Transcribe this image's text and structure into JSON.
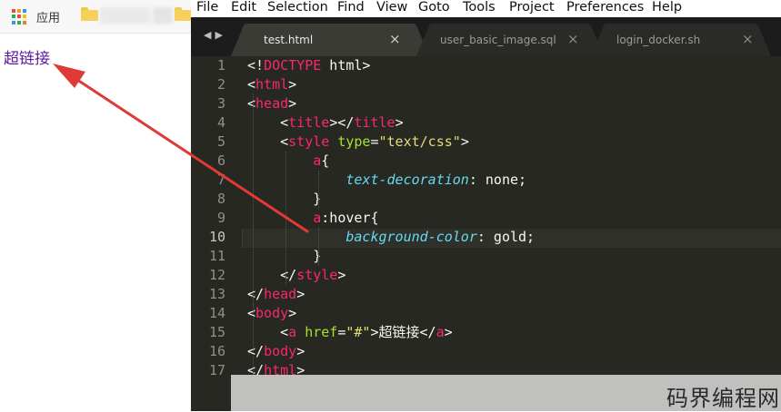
{
  "browser": {
    "bookmarks": {
      "apps_label": "应用"
    },
    "page": {
      "link_text": "超链接",
      "link_color": "#5a1aa1"
    }
  },
  "editor": {
    "menu": [
      "File",
      "Edit",
      "Selection",
      "Find",
      "View",
      "Goto",
      "Tools",
      "Project",
      "Preferences",
      "Help"
    ],
    "tabs": [
      {
        "label": "test.html",
        "active": true
      },
      {
        "label": "user_basic_image.sql",
        "active": false
      },
      {
        "label": "login_docker.sh",
        "active": false
      }
    ],
    "close_glyph": "×",
    "current_line": 10,
    "line_numbers": [
      "1",
      "2",
      "3",
      "4",
      "5",
      "6",
      "7",
      "8",
      "9",
      "10",
      "11",
      "12",
      "13",
      "14",
      "15",
      "16",
      "17"
    ],
    "code": [
      [
        [
          "p",
          "<!"
        ],
        [
          "t",
          "DOCTYPE"
        ],
        [
          "p",
          " html>"
        ]
      ],
      [
        [
          "p",
          "<"
        ],
        [
          "t",
          "html"
        ],
        [
          "p",
          ">"
        ]
      ],
      [
        [
          "p",
          "<"
        ],
        [
          "t",
          "head"
        ],
        [
          "p",
          ">"
        ]
      ],
      [
        [
          "p",
          "    <"
        ],
        [
          "t",
          "title"
        ],
        [
          "p",
          "></"
        ],
        [
          "t",
          "title"
        ],
        [
          "p",
          ">"
        ]
      ],
      [
        [
          "p",
          "    <"
        ],
        [
          "t",
          "style"
        ],
        [
          "p",
          " "
        ],
        [
          "a",
          "type"
        ],
        [
          "p",
          "="
        ],
        [
          "s",
          "\"text/css\""
        ],
        [
          "p",
          ">"
        ]
      ],
      [
        [
          "p",
          "        "
        ],
        [
          "t",
          "a"
        ],
        [
          "p",
          "{"
        ]
      ],
      [
        [
          "p",
          "            "
        ],
        [
          "k",
          "text-decoration"
        ],
        [
          "p",
          ": none;"
        ]
      ],
      [
        [
          "p",
          "        }"
        ]
      ],
      [
        [
          "p",
          "        "
        ],
        [
          "t",
          "a"
        ],
        [
          "p",
          ":hover{"
        ]
      ],
      [
        [
          "p",
          "            "
        ],
        [
          "k",
          "background-color"
        ],
        [
          "p",
          ": gold;"
        ]
      ],
      [
        [
          "p",
          "        }"
        ]
      ],
      [
        [
          "p",
          "    </"
        ],
        [
          "t",
          "style"
        ],
        [
          "p",
          ">"
        ]
      ],
      [
        [
          "p",
          "</"
        ],
        [
          "t",
          "head"
        ],
        [
          "p",
          ">"
        ]
      ],
      [
        [
          "p",
          "<"
        ],
        [
          "t",
          "body"
        ],
        [
          "p",
          ">"
        ]
      ],
      [
        [
          "p",
          "    <"
        ],
        [
          "t",
          "a"
        ],
        [
          "p",
          " "
        ],
        [
          "a",
          "href"
        ],
        [
          "p",
          "="
        ],
        [
          "s",
          "\"#\""
        ],
        [
          "p",
          ">超链接</"
        ],
        [
          "t",
          "a"
        ],
        [
          "p",
          ">"
        ]
      ],
      [
        [
          "p",
          "</"
        ],
        [
          "t",
          "body"
        ],
        [
          "p",
          ">"
        ]
      ],
      [
        [
          "p",
          "</"
        ],
        [
          "t",
          "html"
        ],
        [
          "p",
          ">"
        ]
      ]
    ]
  },
  "watermark": {
    "text": "码界编程网"
  },
  "colors": {
    "annotation_arrow": "#e03a36",
    "tag": "#f92672",
    "attribute": "#a6e22e",
    "string": "#e6db74",
    "property": "#66d9ef",
    "editor_background": "#272822"
  }
}
